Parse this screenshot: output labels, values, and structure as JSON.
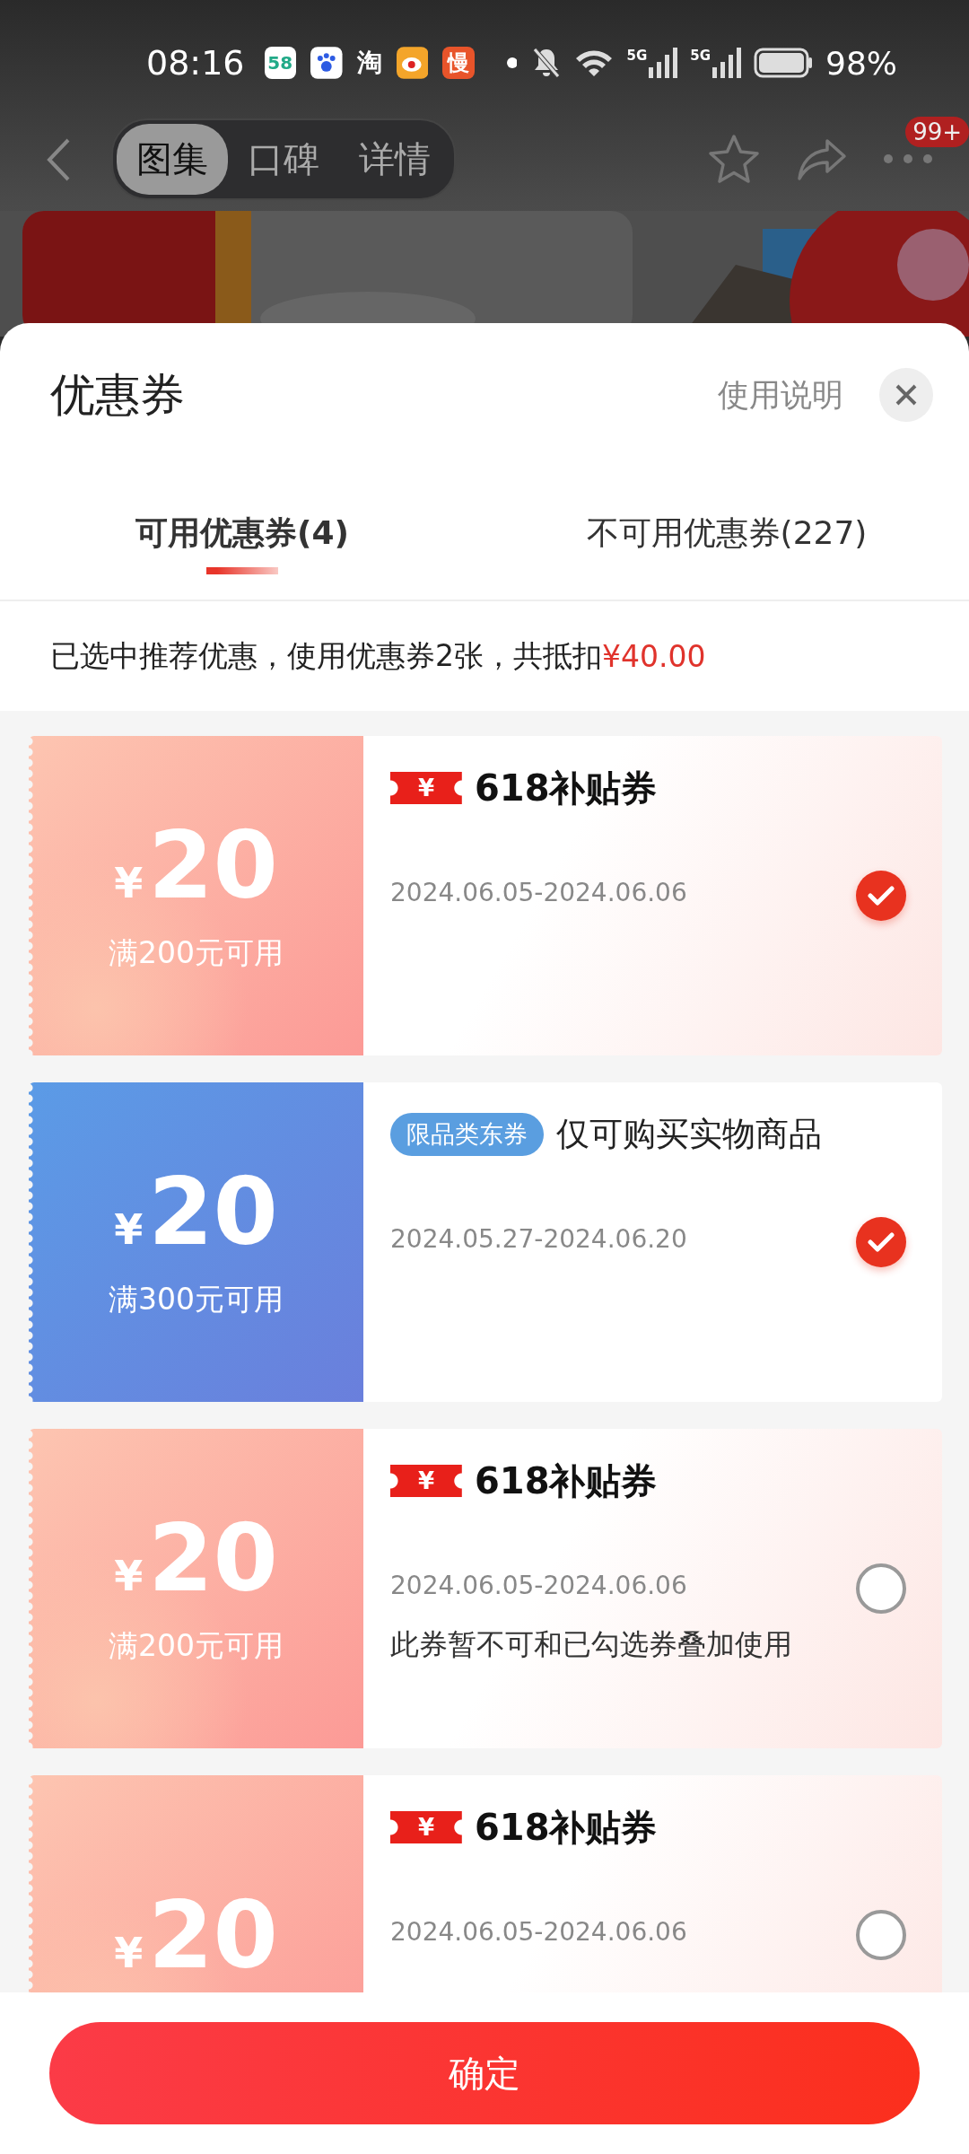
{
  "status_bar": {
    "time": "08:16",
    "notifications": [
      {
        "kind": "tile",
        "label": "58"
      },
      {
        "kind": "paw"
      },
      {
        "kind": "glyph",
        "label": "淘"
      },
      {
        "kind": "eye"
      },
      {
        "kind": "tile-orange",
        "label": "慢"
      },
      {
        "kind": "dot"
      }
    ],
    "signals": [
      {
        "label": "5G"
      },
      {
        "label": "5G"
      }
    ],
    "battery": "98%"
  },
  "nav": {
    "segments": [
      {
        "label": "图集",
        "selected": true
      },
      {
        "label": "口碑",
        "selected": false
      },
      {
        "label": "详情",
        "selected": false
      }
    ],
    "badge": "99+"
  },
  "sheet": {
    "title": "优惠券",
    "help_link": "使用说明",
    "tabs": [
      {
        "label": "可用优惠券(4)",
        "selected": true
      },
      {
        "label": "不可用优惠券(227)",
        "selected": false
      }
    ],
    "summary": {
      "text": "已选中推荐优惠，使用优惠券2张，共抵扣",
      "amount": "¥40.00"
    },
    "coupons": [
      {
        "kind": "subsidy",
        "currency": "¥",
        "amount": "20",
        "condition": "满200元可用",
        "tag": "¥",
        "title": "618补贴券",
        "date": "2024.06.05-2024.06.06",
        "selected": true
      },
      {
        "kind": "category",
        "currency": "¥",
        "amount": "20",
        "condition": "满300元可用",
        "tag": "限品类东券",
        "title": "仅可购买实物商品",
        "date": "2024.05.27-2024.06.20",
        "selected": true
      },
      {
        "kind": "subsidy",
        "currency": "¥",
        "amount": "20",
        "condition": "满200元可用",
        "tag": "¥",
        "title": "618补贴券",
        "date": "2024.06.05-2024.06.06",
        "note": "此券暂不可和已勾选券叠加使用",
        "selected": false
      },
      {
        "kind": "subsidy",
        "currency": "¥",
        "amount": "20",
        "tag": "¥",
        "title": "618补贴券",
        "date": "2024.06.05-2024.06.06",
        "selected": false
      }
    ],
    "confirm_button": "确定"
  }
}
